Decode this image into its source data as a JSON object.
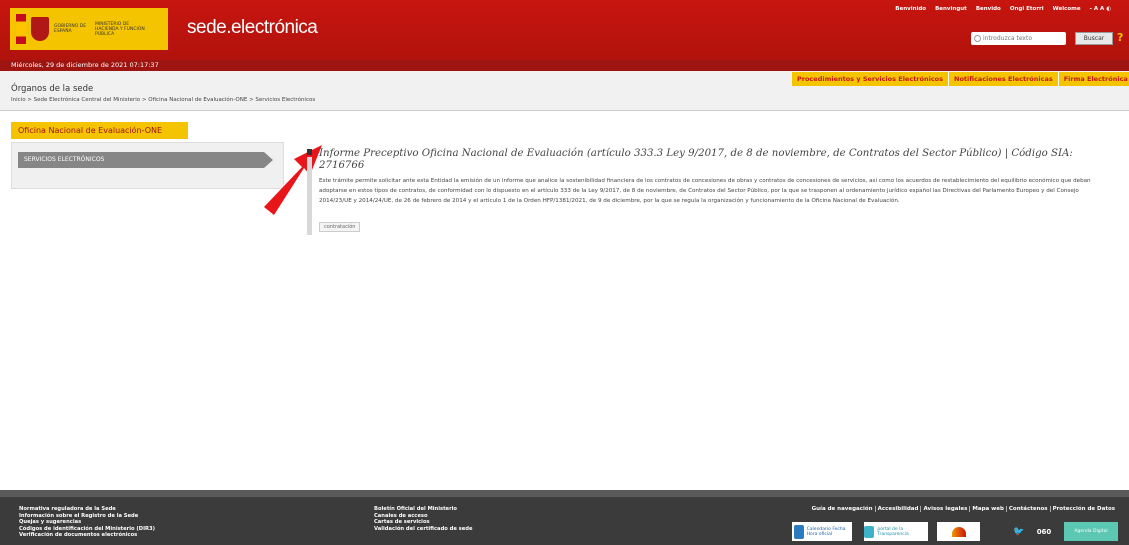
{
  "header": {
    "gov_text": "GOBIERNO DE ESPAÑA",
    "ministry_text": "MINISTERIO DE HACIENDA Y FUNCIÓN PÚBLICA",
    "site_name": "sede.electrónica",
    "top_links": [
      "Benvinido",
      "Benvingut",
      "Benvido",
      "Ongi Etorri",
      "Welcome"
    ],
    "lang_controls": "- A A ◐",
    "search": {
      "placeholder": "introduzca texto",
      "button": "Buscar"
    },
    "help": "?"
  },
  "date_bar": {
    "text": "Miércoles, 29 de diciembre de 2021   07:17:37"
  },
  "subheader": {
    "title": "Órganos de la sede",
    "breadcrumb": "Inicio > Sede Electrónica Central del Ministerio > Oficina Nacional de Evaluación-ONE > Servicios Electrónicos",
    "tabs": [
      "Procedimientos y Servicios Electrónicos",
      "Notificaciones Electrónicas",
      "Firma Electrónica"
    ]
  },
  "sidebar": {
    "office": "Oficina Nacional de Evaluación-ONE",
    "item": "SERVICIOS ELECTRÓNICOS"
  },
  "result": {
    "title": "Informe Preceptivo Oficina Nacional de Evaluación (artículo 333.3 Ley 9/2017, de 8 de noviembre, de Contratos del Sector Público) | Código SIA: 2716766",
    "description": "Este trámite permite solicitar ante esta Entidad la emisión de un informe que analice la sostenibilidad financiera de los contratos de concesiones de obras y contratos de concesiones de servicios, así como los acuerdos de restablecimiento del equilibrio económico que deban adoptarse en estos tipos de contratos, de conformidad con lo dispuesto en el artículo 333 de la Ley 9/2017, de 8 de noviembre, de Contratos del Sector Público, por la que se trasponen al ordenamiento jurídico español las Directivas del Parlamento Europeo y del Consejo 2014/23/UE y 2014/24/UE, de 26 de febrero de 2014 y el artículo 1 de la Orden HFP/1381/2021, de 9 de diciembre, por la que se regula la organización y funcionamiento de la Oficina Nacional de Evaluación.",
    "tag": "contratación"
  },
  "footer": {
    "col1": [
      "Normativa reguladora de la Sede",
      "Información sobre el Registro de la Sede",
      "Quejas y sugerencias",
      "Códigos de identificación del Ministerio (DIR3)",
      "Verificación de documentos electrónicos"
    ],
    "col2": [
      "Boletín Oficial del Ministerio",
      "Canales de acceso",
      "Cartas de servicios",
      "Validación del certificado de sede"
    ],
    "links": [
      "Guía de navegación",
      "Accesibilidad",
      "Avisos legales",
      "Mapa web",
      "Contáctenos",
      "Protección de Datos"
    ],
    "badges": {
      "calendario": "Calendario Fecha Hora oficial",
      "transparencia": "portal de la Transparencia",
      "gobes": "gob.es",
      "tuit": "🐦",
      "n060": "060",
      "agenda": "Agenda Digital"
    }
  }
}
